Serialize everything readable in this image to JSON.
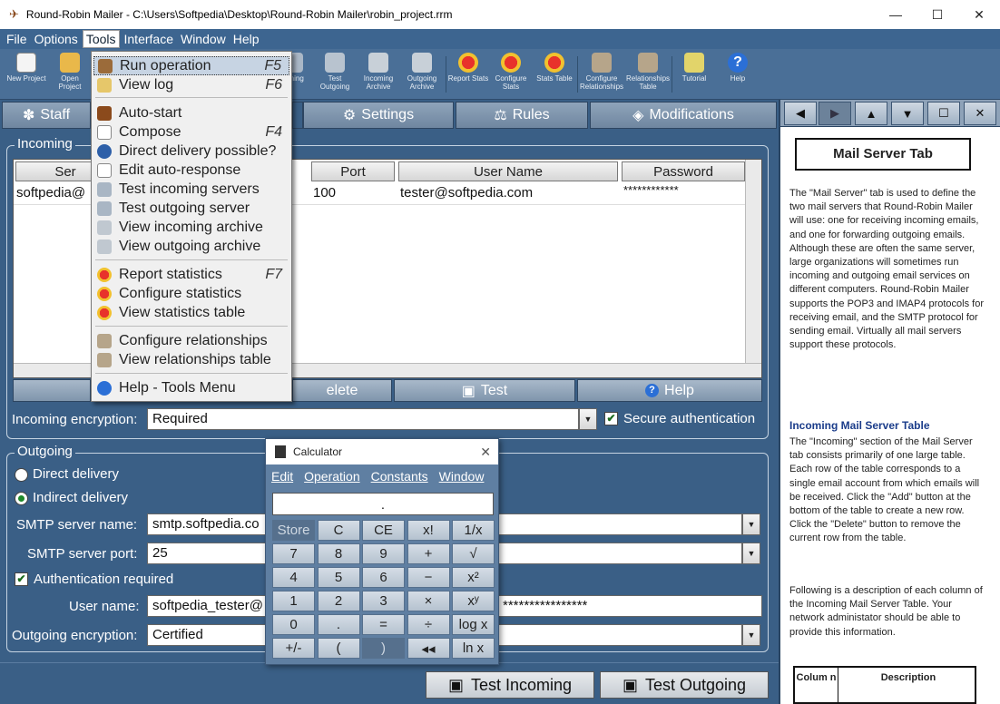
{
  "window": {
    "title": "Round-Robin Mailer - C:\\Users\\Softpedia\\Desktop\\Round-Robin Mailer\\robin_project.rrm"
  },
  "menu": [
    "File",
    "Options",
    "Tools",
    "Interface",
    "Window",
    "Help"
  ],
  "toolbar": [
    {
      "label": "New Project",
      "icon": "new-project-icon"
    },
    {
      "label": "Open Project",
      "icon": "open-project-icon"
    },
    {
      "label": "st ning",
      "icon": "test-incoming-partial-icon"
    },
    {
      "label": "Test Outgoing",
      "icon": "test-outgoing-icon"
    },
    {
      "label": "Incoming Archive",
      "icon": "incoming-archive-icon"
    },
    {
      "label": "Outgoing Archive",
      "icon": "outgoing-archive-icon"
    },
    {
      "label": "Report Stats",
      "icon": "report-stats-icon"
    },
    {
      "label": "Configure Stats",
      "icon": "configure-stats-icon"
    },
    {
      "label": "Stats Table",
      "icon": "stats-table-icon"
    },
    {
      "label": "Configure Relationships",
      "icon": "configure-relationships-icon"
    },
    {
      "label": "Relationships Table",
      "icon": "relationships-table-icon"
    },
    {
      "label": "Tutorial",
      "icon": "tutorial-icon"
    },
    {
      "label": "Help",
      "icon": "help-icon"
    }
  ],
  "tabs": {
    "staff": "Staff",
    "settings": "Settings",
    "rules": "Rules",
    "modifications": "Modifications"
  },
  "incoming": {
    "label": "Incoming",
    "columns": [
      "Ser",
      "Port",
      "User Name",
      "Password"
    ],
    "row": {
      "server": "softpedia@",
      "port": "100",
      "user": "tester@softpedia.com",
      "password": "************"
    },
    "buttons": {
      "delete": "elete",
      "test": "Test",
      "help": "Help"
    },
    "encryption_label": "Incoming encryption:",
    "encryption_value": "Required",
    "secure_auth": "Secure authentication"
  },
  "outgoing": {
    "label": "Outgoing",
    "direct": "Direct delivery",
    "indirect": "Indirect delivery",
    "smtp_name_label": "SMTP server name:",
    "smtp_name_value": "smtp.softpedia.co",
    "smtp_port_label": "SMTP server port:",
    "smtp_port_value": "25",
    "auth_required": "Authentication required",
    "user_label": "User name:",
    "user_value": "softpedia_tester@",
    "password_value": "****************",
    "encryption_label": "Outgoing encryption:",
    "encryption_value": "Certified"
  },
  "bottom_buttons": {
    "test_incoming": "Test Incoming",
    "test_outgoing": "Test Outgoing"
  },
  "help_pane": {
    "title": "Mail Server Tab",
    "p1": "The \"Mail Server\" tab is used to define the two mail servers that Round-Robin Mailer will use:  one for receiving incoming emails, and one for forwarding outgoing emails. Although these are often the same server, large organizations will sometimes run incoming and outgoing email services on different computers.  Round-Robin Mailer supports the POP3 and IMAP4 protocols for receiving email, and the SMTP protocol for sending email. Virtually all mail servers support these protocols.",
    "h2": "Incoming Mail Server Table",
    "p2": "The \"Incoming\" section of the Mail Server tab consists primarily of one large table.  Each row of the table corresponds to a single email account from which emails will be received.  Click the \"Add\" button at the bottom of the table to create a new row.  Click the \"Delete\" button to remove the current row from the table.",
    "p3": "Following is a description of each column of the Incoming Mail Server Table.  Your network administator should be able to provide this information.",
    "table_col1": "Colum n",
    "table_col2": "Description"
  },
  "tools_menu": [
    {
      "label": "Run operation",
      "shortcut": "F5"
    },
    {
      "label": "View log",
      "shortcut": "F6"
    },
    {
      "label": "Auto-start",
      "shortcut": ""
    },
    {
      "label": "Compose",
      "shortcut": "F4"
    },
    {
      "label": "Direct delivery possible?",
      "shortcut": ""
    },
    {
      "label": "Edit auto-response",
      "shortcut": ""
    },
    {
      "label": "Test incoming servers",
      "shortcut": ""
    },
    {
      "label": "Test outgoing server",
      "shortcut": ""
    },
    {
      "label": "View incoming archive",
      "shortcut": ""
    },
    {
      "label": "View outgoing archive",
      "shortcut": ""
    },
    {
      "label": "Report statistics",
      "shortcut": "F7"
    },
    {
      "label": "Configure statistics",
      "shortcut": ""
    },
    {
      "label": "View statistics table",
      "shortcut": ""
    },
    {
      "label": "Configure relationships",
      "shortcut": ""
    },
    {
      "label": "View relationships table",
      "shortcut": ""
    },
    {
      "label": "Help - Tools Menu",
      "shortcut": ""
    }
  ],
  "calculator": {
    "title": "Calculator",
    "menu": [
      "Edit",
      "Operation",
      "Constants",
      "Window"
    ],
    "display": ".",
    "keys": [
      [
        "Store",
        "C",
        "CE",
        "x!",
        "1/x"
      ],
      [
        "7",
        "8",
        "9",
        "+",
        "√"
      ],
      [
        "4",
        "5",
        "6",
        "−",
        "x²"
      ],
      [
        "1",
        "2",
        "3",
        "×",
        "xʸ"
      ],
      [
        "0",
        ".",
        "=",
        "÷",
        "log x"
      ],
      [
        "+/-",
        "(",
        ")",
        "◂◂",
        "ln x"
      ]
    ]
  }
}
